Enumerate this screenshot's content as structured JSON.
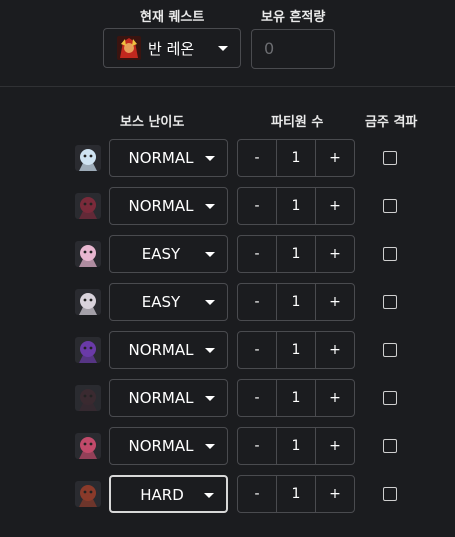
{
  "header": {
    "current_quest_label": "현재 퀘스트",
    "trace_label": "보유 흔적량",
    "quest_value": "반 레온",
    "trace_placeholder": "0"
  },
  "columns": {
    "difficulty": "보스 난이도",
    "party": "파티원 수",
    "weekly": "금주 격파"
  },
  "stepper": {
    "minus": "-",
    "plus": "+"
  },
  "bosses": [
    {
      "icon": "boss-1-icon",
      "difficulty": "NORMAL",
      "party": "1",
      "checked": false,
      "color": "#cfe3f2"
    },
    {
      "icon": "boss-2-icon",
      "difficulty": "NORMAL",
      "party": "1",
      "checked": false,
      "color": "#7a2a3a"
    },
    {
      "icon": "boss-3-icon",
      "difficulty": "EASY",
      "party": "1",
      "checked": false,
      "color": "#e8b7d0"
    },
    {
      "icon": "boss-4-icon",
      "difficulty": "EASY",
      "party": "1",
      "checked": false,
      "color": "#d9d3dc"
    },
    {
      "icon": "boss-5-icon",
      "difficulty": "NORMAL",
      "party": "1",
      "checked": false,
      "color": "#6a3aa8"
    },
    {
      "icon": "boss-6-icon",
      "difficulty": "NORMAL",
      "party": "1",
      "checked": false,
      "color": "#3a2a30"
    },
    {
      "icon": "boss-7-icon",
      "difficulty": "NORMAL",
      "party": "1",
      "checked": false,
      "color": "#c14a6a"
    },
    {
      "icon": "boss-8-icon",
      "difficulty": "HARD",
      "party": "1",
      "checked": false,
      "color": "#8a3a2a"
    }
  ]
}
